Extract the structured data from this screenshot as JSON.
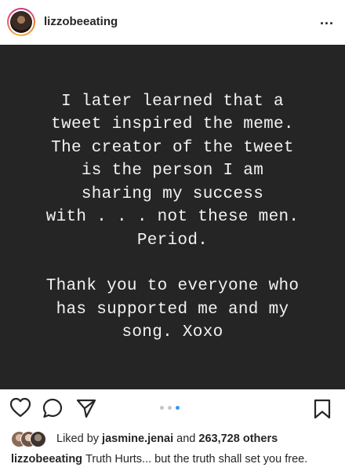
{
  "header": {
    "username": "lizzobeeating",
    "more_label": "..."
  },
  "story": {
    "paragraph1": [
      "I later learned that a",
      "tweet inspired the meme.",
      "The creator of the tweet",
      "is the person I am",
      "sharing my success",
      "with . . . not these men.",
      "Period."
    ],
    "paragraph2": [
      "Thank you to everyone who",
      "has supported me and my",
      "song. Xoxo"
    ]
  },
  "actions": {
    "icons": [
      "heart-icon",
      "comment-icon",
      "share-icon",
      "bookmark-icon"
    ],
    "carousel_dots": 3,
    "active_dot": 3,
    "accent_color": "#3897f0"
  },
  "likes": {
    "prefix": "Liked by",
    "user": "jasmine.jenai",
    "middle": "and",
    "count": "263,728 others"
  },
  "caption": {
    "username": "lizzobeeating",
    "text": "Truth Hurts... but the truth shall set you free."
  }
}
